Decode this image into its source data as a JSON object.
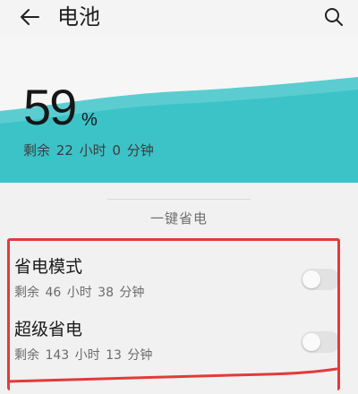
{
  "header": {
    "title": "电池",
    "back_icon": "arrow-left-icon",
    "search_icon": "search-icon"
  },
  "battery": {
    "level_number": "59",
    "level_unit": "%",
    "remaining": "剩余 22 小时 0 分钟",
    "wave_color": "#3cc3c8"
  },
  "one_key_section": {
    "label": "一键省电"
  },
  "modes": [
    {
      "title": "省电模式",
      "remaining": "剩余 46 小时 38 分钟",
      "enabled": false
    },
    {
      "title": "超级省电",
      "remaining": "剩余 143 小时 13 分钟",
      "enabled": false
    }
  ],
  "colors": {
    "highlight_border": "#e43a3a",
    "accent_teal": "#3cc3c8"
  }
}
